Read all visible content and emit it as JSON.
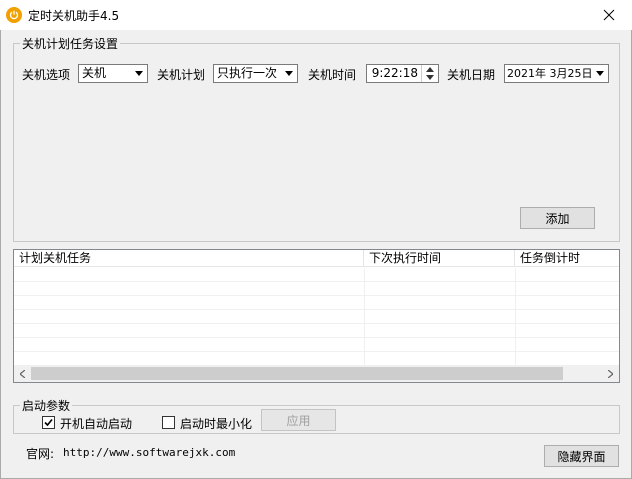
{
  "window": {
    "title": "定时关机助手4.5"
  },
  "task_settings": {
    "group_label": "关机计划任务设置",
    "option_label": "关机选项",
    "option_value": "关机",
    "plan_label": "关机计划",
    "plan_value": "只执行一次",
    "time_label": "关机时间",
    "time_value": "9:22:18",
    "date_label": "关机日期",
    "date_value": "2021年 3月25日",
    "add_button": "添加"
  },
  "task_list": {
    "columns": [
      "计划关机任务",
      "下次执行时间",
      "任务倒计时"
    ],
    "rows": []
  },
  "startup": {
    "group_label": "启动参数",
    "autostart_label": "开机自动启动",
    "autostart_checked": true,
    "minimize_label": "启动时最小化",
    "minimize_checked": false,
    "apply_button": "应用"
  },
  "footer": {
    "site_label": "官网: ",
    "site_url": "http://www.softwarejxk.com",
    "hide_button": "隐藏界面"
  },
  "colors": {
    "app_icon": "#f2a000"
  }
}
